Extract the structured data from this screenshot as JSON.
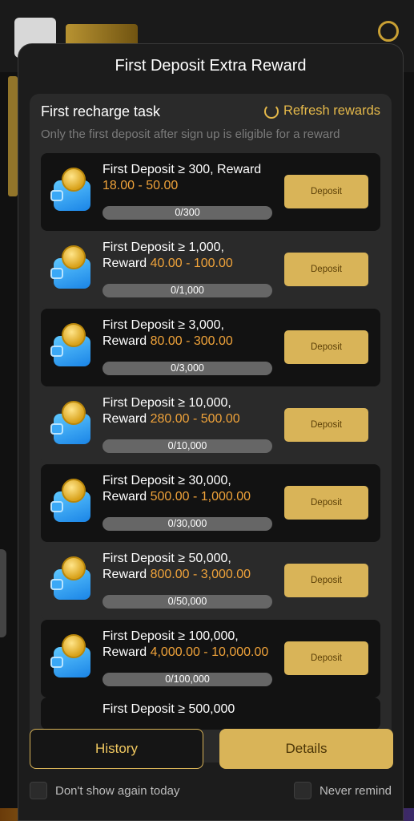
{
  "modal": {
    "title": "First Deposit Extra Reward"
  },
  "task": {
    "heading": "First recharge task",
    "refresh_label": "Refresh rewards",
    "note": "Only the first deposit after sign up is eligible for a reward"
  },
  "rows": [
    {
      "line1": "First Deposit ≥ 300, Reward",
      "line2_prefix": "",
      "reward": "18.00 - 50.00",
      "progress_text": "0/300",
      "progress": 0,
      "button": "Deposit"
    },
    {
      "line1": "First Deposit ≥ 1,000,",
      "line2_prefix": "Reward ",
      "reward": "40.00 - 100.00",
      "progress_text": "0/1,000",
      "progress": 0,
      "button": "Deposit"
    },
    {
      "line1": "First Deposit ≥ 3,000,",
      "line2_prefix": "Reward ",
      "reward": "80.00 - 300.00",
      "progress_text": "0/3,000",
      "progress": 0,
      "button": "Deposit"
    },
    {
      "line1": "First Deposit ≥ 10,000,",
      "line2_prefix": "Reward ",
      "reward": "280.00 - 500.00",
      "progress_text": "0/10,000",
      "progress": 0,
      "button": "Deposit"
    },
    {
      "line1": "First Deposit ≥ 30,000,",
      "line2_prefix": "Reward ",
      "reward": "500.00 - 1,000.00",
      "progress_text": "0/30,000",
      "progress": 0,
      "button": "Deposit"
    },
    {
      "line1": "First Deposit ≥ 50,000,",
      "line2_prefix": "Reward ",
      "reward": "800.00 - 3,000.00",
      "progress_text": "0/50,000",
      "progress": 0,
      "button": "Deposit"
    },
    {
      "line1": "First Deposit ≥ 100,000,",
      "line2_prefix": "Reward ",
      "reward": "4,000.00 - 10,000.00",
      "progress_text": "0/100,000",
      "progress": 0,
      "button": "Deposit"
    }
  ],
  "partial_row": {
    "line1": "First Deposit ≥ 500,000"
  },
  "footer": {
    "history": "History",
    "details": "Details",
    "dont_show": "Don't show again today",
    "never_remind": "Never remind"
  },
  "colors": {
    "accent": "#d9b458",
    "reward": "#f0a33a",
    "panel": "#1c1c1c"
  }
}
